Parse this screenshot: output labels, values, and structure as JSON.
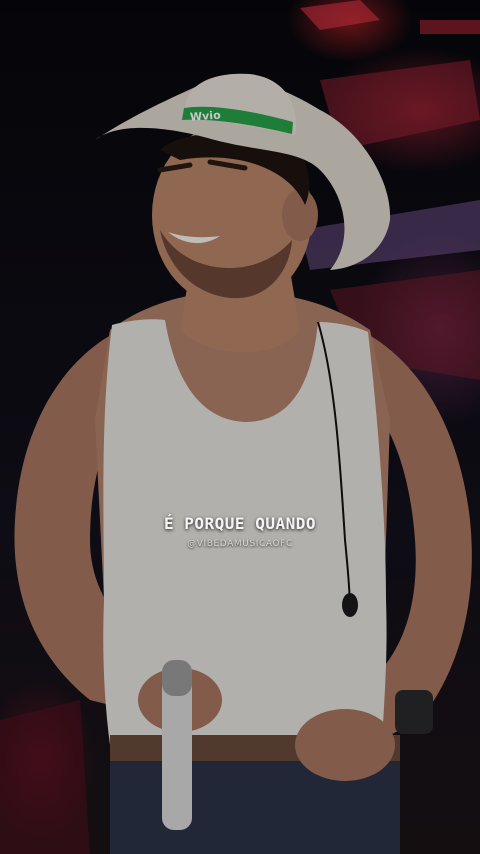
{
  "photo": {
    "hat_band_text": "Wvio"
  },
  "caption": {
    "lyric": "É PORQUE QUANDO",
    "handle": "@VIBEDAMUSICAOFC"
  },
  "colors": {
    "hat": "#dcd6cc",
    "hat_band": "#27a04a",
    "tank_top": "#e4e2dd",
    "skin": "#b98468",
    "stage_red": "#c8283c",
    "stage_purple": "#a03c78"
  }
}
